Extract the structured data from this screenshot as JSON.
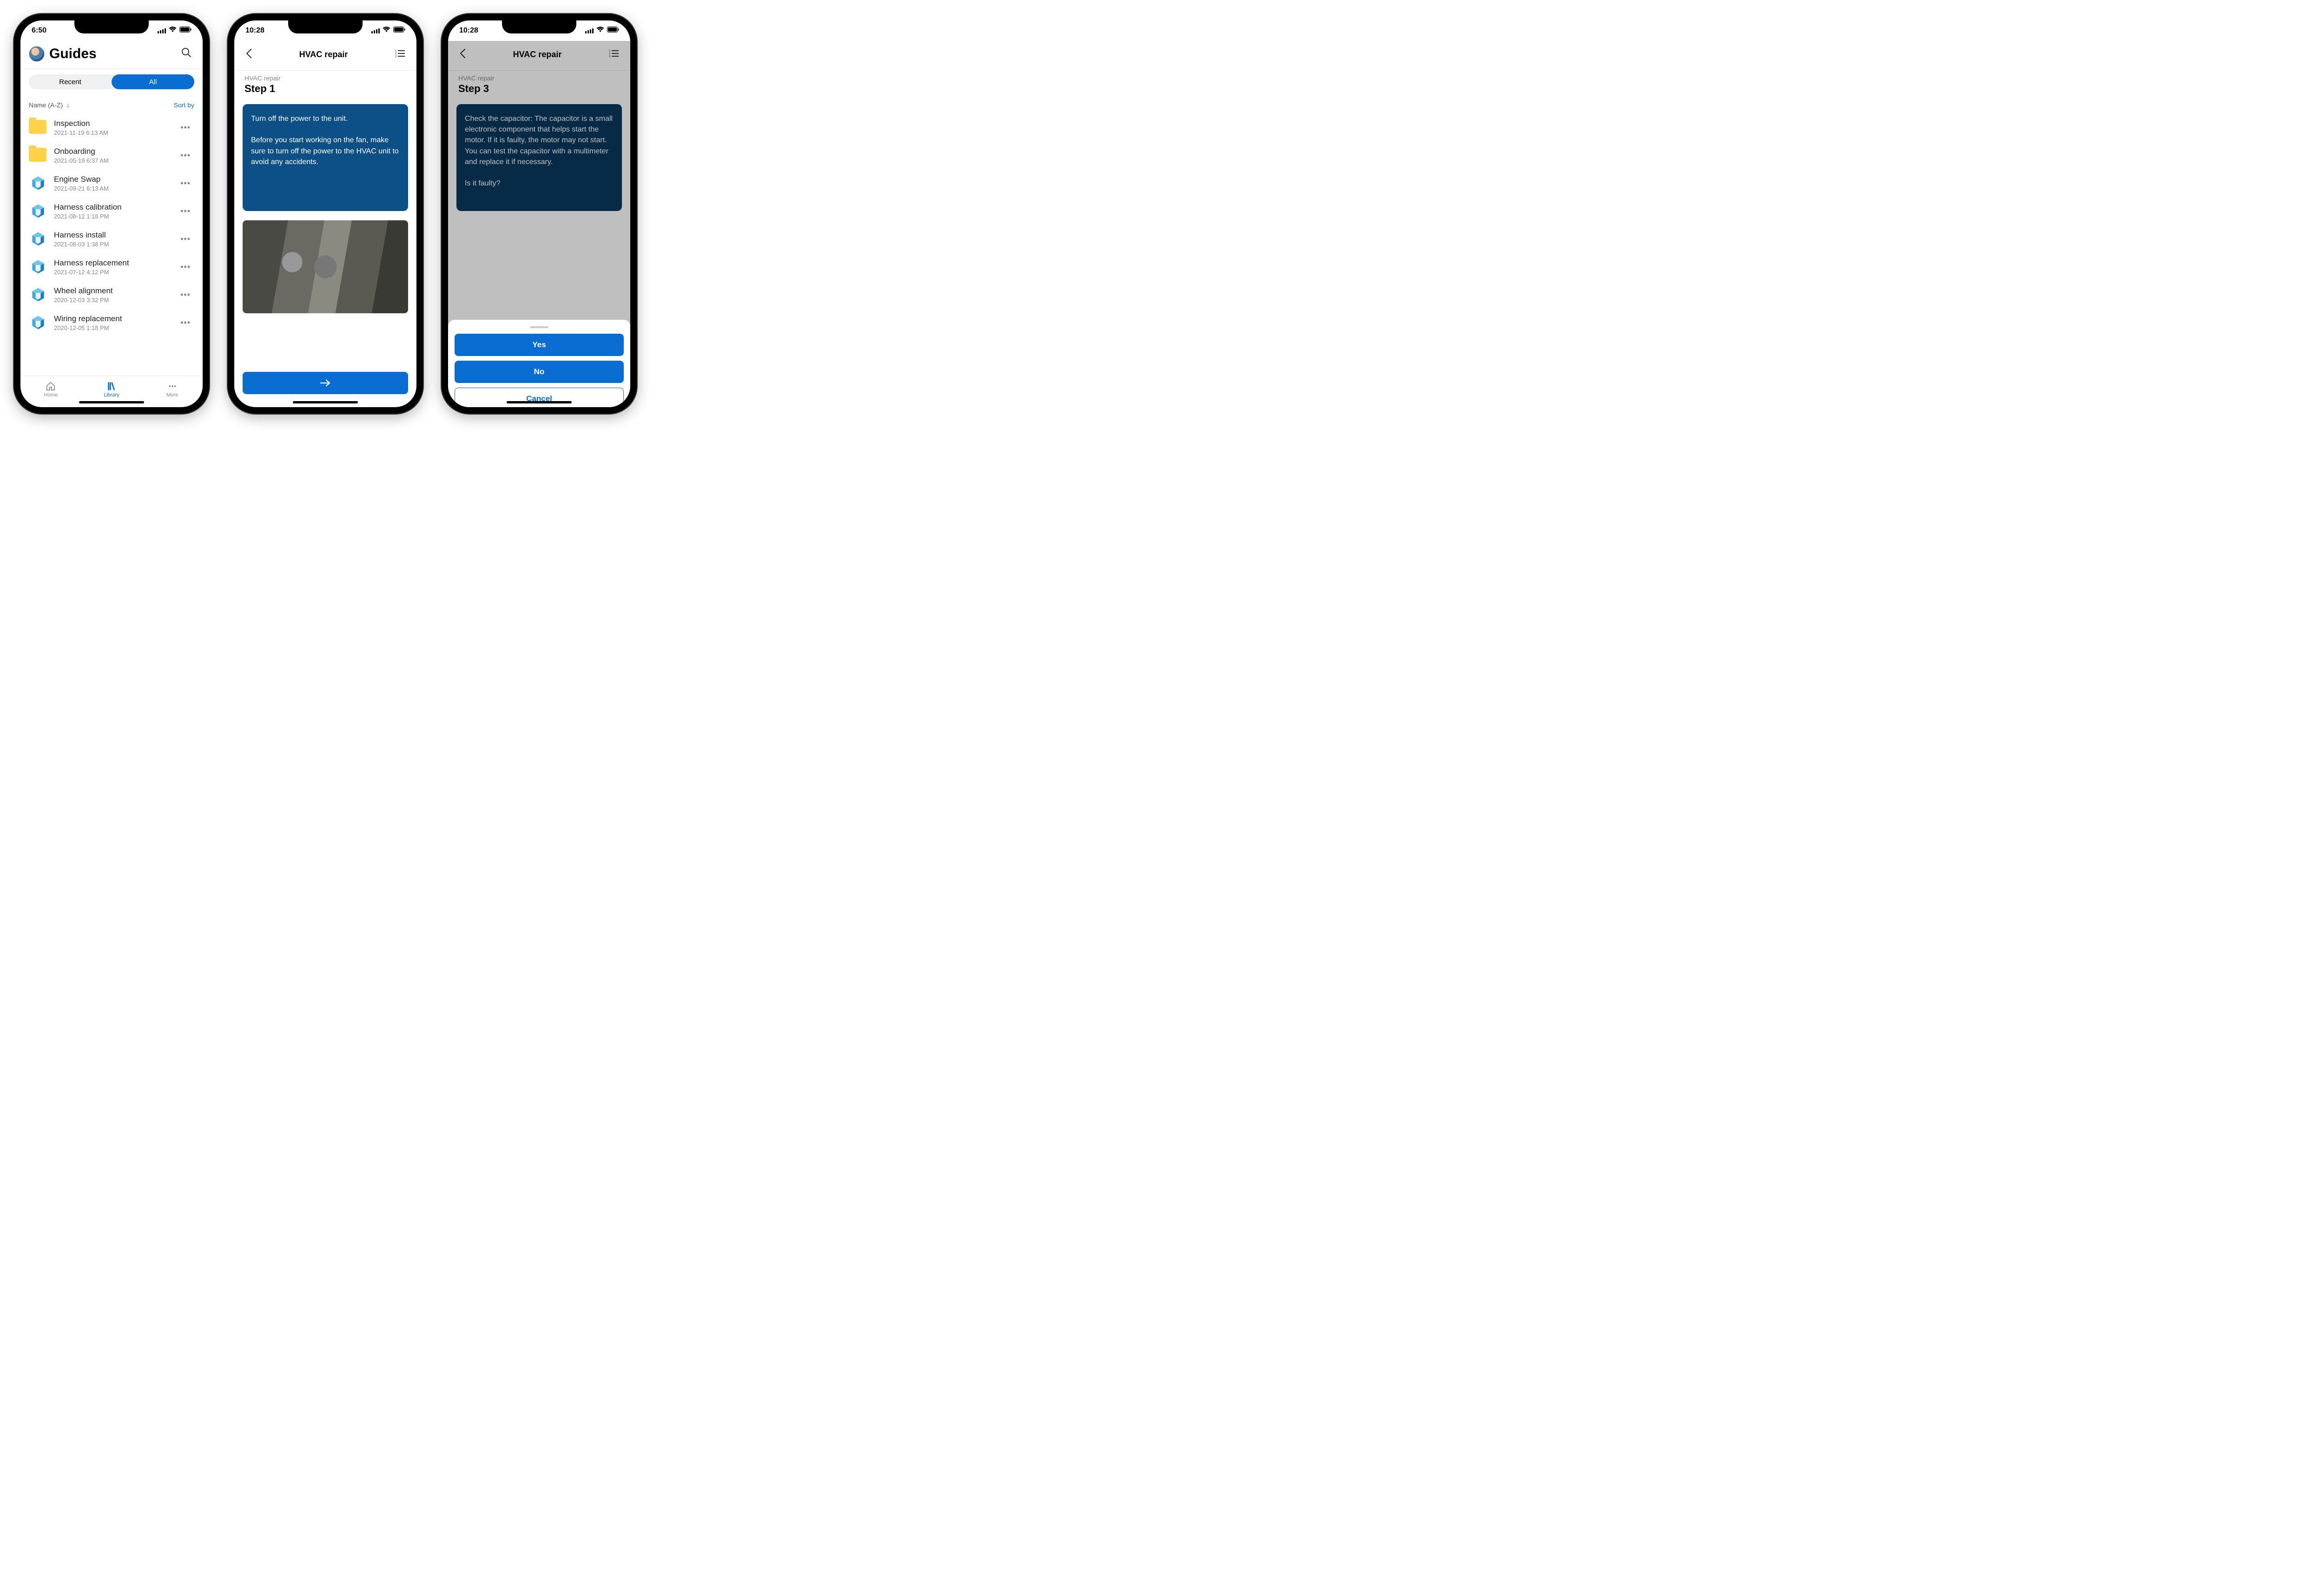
{
  "phone1": {
    "status_time": "6:50",
    "title": "Guides",
    "tabs": {
      "recent": "Recent",
      "all": "All"
    },
    "sort_label": "Name (A-Z)",
    "sort_by": "Sort by",
    "items": [
      {
        "icon": "folder",
        "title": "Inspection",
        "date": "2021-11-19 6:13 AM"
      },
      {
        "icon": "folder",
        "title": "Onboarding",
        "date": "2021-05-19 6:37 AM"
      },
      {
        "icon": "guide",
        "title": "Engine Swap",
        "date": "2021-09-21 6:13 AM"
      },
      {
        "icon": "guide",
        "title": "Harness calibration",
        "date": "2021-08-12 1:18 PM"
      },
      {
        "icon": "guide",
        "title": "Harness install",
        "date": "2021-08-03 1:38 PM"
      },
      {
        "icon": "guide",
        "title": "Harness replacement",
        "date": "2021-07-12 4:12 PM"
      },
      {
        "icon": "guide",
        "title": "Wheel alignment",
        "date": "2020-12-03 3:32 PM"
      },
      {
        "icon": "guide",
        "title": "Wiring replacement",
        "date": "2020-12-05 1:18 PM"
      }
    ],
    "nav": {
      "home": "Home",
      "library": "Library",
      "more": "More"
    }
  },
  "phone2": {
    "status_time": "10:28",
    "title": "HVAC repair",
    "meta": "HVAC repair",
    "step": "Step 1",
    "instruction": "Turn off the power to the unit.\n\nBefore you start working on the fan, make sure to turn off the power to the HVAC unit to avoid any accidents."
  },
  "phone3": {
    "status_time": "10:28",
    "title": "HVAC repair",
    "meta": "HVAC repair",
    "step": "Step 3",
    "instruction": "Check the capacitor: The capacitor is a small electronic component that helps start the motor. If it is faulty, the motor may not start. You can test the capacitor with a multimeter and replace it if necessary.\n\nIs it faulty?",
    "sheet": {
      "yes": "Yes",
      "no": "No",
      "cancel": "Cancel"
    }
  }
}
